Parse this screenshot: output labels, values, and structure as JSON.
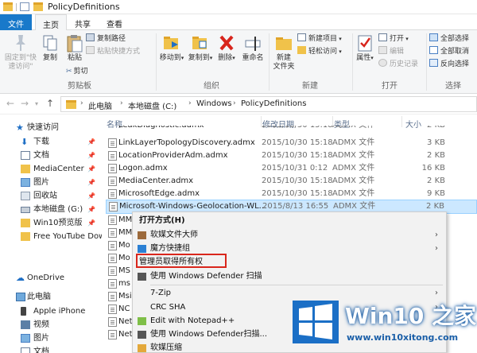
{
  "window": {
    "title": "PolicyDefinitions"
  },
  "tabs": {
    "file": "文件",
    "home": "主页",
    "share": "共享",
    "view": "查看"
  },
  "ribbon": {
    "pin_quick_access": "固定到\"快\n速访问\"",
    "copy": "复制",
    "paste": "粘贴",
    "copy_path": "复制路径",
    "paste_shortcut": "粘贴快捷方式",
    "cut": "剪切",
    "clipboard_group": "剪贴板",
    "move_to": "移动到",
    "copy_to": "复制到",
    "delete": "删除",
    "rename": "重命名",
    "organize_group": "组织",
    "new_folder": "新建\n文件夹",
    "new_item": "新建项目",
    "easy_access": "轻松访问",
    "new_group": "新建",
    "properties": "属性",
    "open": "打开",
    "edit": "编辑",
    "history": "历史记录",
    "open_group": "打开",
    "select_all": "全部选择",
    "select_none": "全部取消",
    "invert_selection": "反向选择",
    "select_group": "选择"
  },
  "address": {
    "crumbs": [
      "此电脑",
      "本地磁盘 (C:)",
      "Windows",
      "PolicyDefinitions"
    ]
  },
  "nav": {
    "items": [
      {
        "label": "快速访问",
        "pinned": false
      },
      {
        "label": "下载",
        "pinned": true
      },
      {
        "label": "文档",
        "pinned": true
      },
      {
        "label": "MediaCenter",
        "pinned": true
      },
      {
        "label": "图片",
        "pinned": true
      },
      {
        "label": "回收站",
        "pinned": true
      },
      {
        "label": "本地磁盘 (G:)",
        "pinned": true
      },
      {
        "label": "Win10预览版",
        "pinned": true
      },
      {
        "label": "Free YouTube Dow",
        "pinned": true
      },
      {
        "label": "OneDrive",
        "pinned": false
      },
      {
        "label": "此电脑",
        "pinned": false
      },
      {
        "label": "Apple iPhone",
        "pinned": false
      },
      {
        "label": "视频",
        "pinned": false
      },
      {
        "label": "图片",
        "pinned": false
      },
      {
        "label": "文档",
        "pinned": false
      }
    ]
  },
  "columns": {
    "name": "名称",
    "date": "修改日期",
    "type": "类型",
    "size": "大小"
  },
  "files": [
    {
      "name": "LeakDiagnostic.admx",
      "date": "2015/10/30 15:18",
      "type": "ADMX 文件",
      "size": "2 KB"
    },
    {
      "name": "LinkLayerTopologyDiscovery.admx",
      "date": "2015/10/30 15:18",
      "type": "ADMX 文件",
      "size": "3 KB"
    },
    {
      "name": "LocationProviderAdm.admx",
      "date": "2015/10/30 15:18",
      "type": "ADMX 文件",
      "size": "2 KB"
    },
    {
      "name": "Logon.admx",
      "date": "2015/10/31 0:12",
      "type": "ADMX 文件",
      "size": "16 KB"
    },
    {
      "name": "MediaCenter.admx",
      "date": "2015/10/30 15:18",
      "type": "ADMX 文件",
      "size": "2 KB"
    },
    {
      "name": "MicrosoftEdge.admx",
      "date": "2015/10/30 15:18",
      "type": "ADMX 文件",
      "size": "9 KB"
    },
    {
      "name": "Microsoft-Windows-Geolocation-WL...",
      "date": "2015/8/13 16:55",
      "type": "ADMX 文件",
      "size": "2 KB"
    },
    {
      "name": "MM",
      "date": "",
      "type": "",
      "size": ""
    },
    {
      "name": "MM",
      "date": "",
      "type": "",
      "size": ""
    },
    {
      "name": "Mo",
      "date": "",
      "type": "",
      "size": ""
    },
    {
      "name": "Mo",
      "date": "",
      "type": "",
      "size": ""
    },
    {
      "name": "MS",
      "date": "",
      "type": "",
      "size": ""
    },
    {
      "name": "ms",
      "date": "",
      "type": "",
      "size": ""
    },
    {
      "name": "Msi",
      "date": "",
      "type": "",
      "size": ""
    },
    {
      "name": "NC",
      "date": "",
      "type": "",
      "size": ""
    },
    {
      "name": "Net",
      "date": "",
      "type": "",
      "size": ""
    },
    {
      "name": "Net",
      "date": "",
      "type": "",
      "size": ""
    }
  ],
  "context_menu": {
    "open_with": "打开方式(H)",
    "rubbish_master": "软媒文件大师",
    "magic_shortcuts": "魔方快捷组",
    "take_ownership": "管理员取得所有权",
    "defender_scan": "使用 Windows Defender 扫描",
    "seven_zip": "7-Zip",
    "crc_sha": "CRC SHA",
    "notepad_pp": "Edit with Notepad++",
    "defender_scan2": "使用 Windows Defender扫描...",
    "compress": "软媒压缩"
  },
  "watermark": {
    "title": "Win10 之家",
    "url": "www.win10xitong.com"
  },
  "colors": {
    "accent": "#1979ca",
    "highlight_border": "#d9261c",
    "selection": "#cce8ff"
  }
}
